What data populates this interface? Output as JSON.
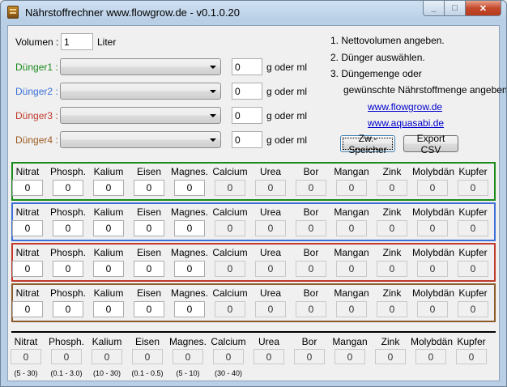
{
  "window": {
    "title": "Nährstoffrechner www.flowgrow.de - v0.1.0.20",
    "caption": {
      "minimize": "_",
      "maximize": "□",
      "close": "✕"
    }
  },
  "volume": {
    "label": "Volumen :",
    "value": "1",
    "unit": "Liter"
  },
  "fertilizers": [
    {
      "label": "Dünger1 :",
      "color": "#1a8a1a",
      "amount": "0",
      "unit": "g oder ml"
    },
    {
      "label": "Dünger2 :",
      "color": "#3a6fd8",
      "amount": "0",
      "unit": "g oder ml"
    },
    {
      "label": "Dünger3 :",
      "color": "#c0392b",
      "amount": "0",
      "unit": "g oder ml"
    },
    {
      "label": "Dünger4 :",
      "color": "#9c5a1e",
      "amount": "0",
      "unit": "g oder ml"
    }
  ],
  "instructions": {
    "step1": "1. Nettovolumen angeben.",
    "step2": "2. Dünger auswählen.",
    "step3": "3. Düngemenge oder",
    "step3b": "gewünschte Nährstoffmenge angeben.",
    "link1": "www.flowgrow.de",
    "link2": "www.aquasabi.de"
  },
  "buttons": {
    "save": "Zw.-Speicher",
    "export": "Export CSV"
  },
  "nutrients": [
    "Nitrat",
    "Phosph.",
    "Kalium",
    "Eisen",
    "Magnes.",
    "Calcium",
    "Urea",
    "Bor",
    "Mangan",
    "Zink",
    "Molybdän",
    "Kupfer"
  ],
  "group_colors": [
    "#1a8a1a",
    "#3a6fd8",
    "#c0392b",
    "#8a5a2a"
  ],
  "group_values": [
    [
      "0",
      "0",
      "0",
      "0",
      "0",
      "0",
      "0",
      "0",
      "0",
      "0",
      "0",
      "0"
    ],
    [
      "0",
      "0",
      "0",
      "0",
      "0",
      "0",
      "0",
      "0",
      "0",
      "0",
      "0",
      "0"
    ],
    [
      "0",
      "0",
      "0",
      "0",
      "0",
      "0",
      "0",
      "0",
      "0",
      "0",
      "0",
      "0"
    ],
    [
      "0",
      "0",
      "0",
      "0",
      "0",
      "0",
      "0",
      "0",
      "0",
      "0",
      "0",
      "0"
    ]
  ],
  "totals": [
    "0",
    "0",
    "0",
    "0",
    "0",
    "0",
    "0",
    "0",
    "0",
    "0",
    "0",
    "0"
  ],
  "ranges": [
    "(5 - 30)",
    "(0.1 - 3.0)",
    "(10 - 30)",
    "(0.1 - 0.5)",
    "(5 - 10)",
    "(30 - 40)"
  ]
}
